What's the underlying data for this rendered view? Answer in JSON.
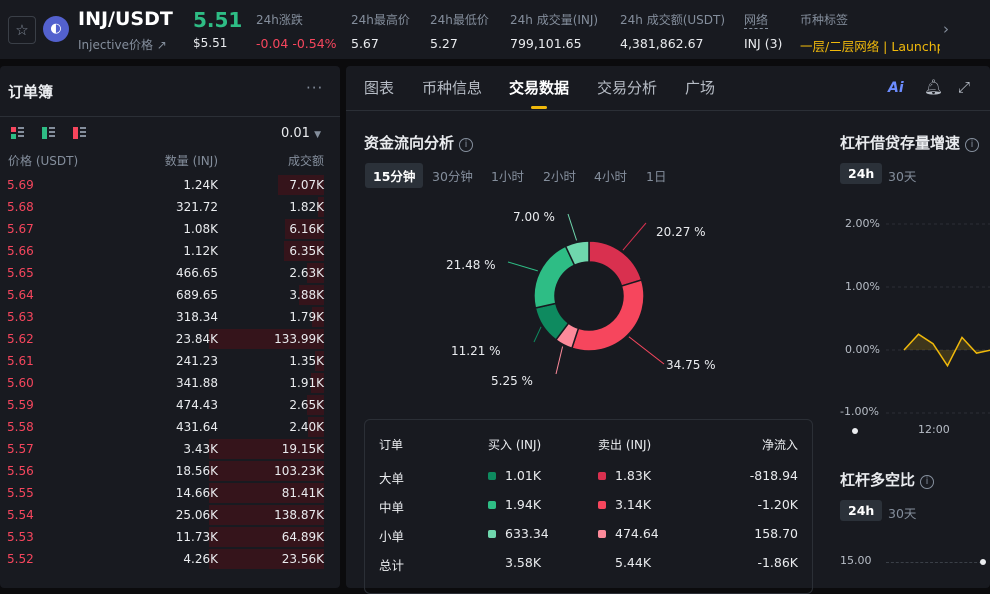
{
  "header": {
    "pair": "INJ/USDT",
    "subtitle": "Injective价格 ↗",
    "price": "5.51",
    "price_usd": "$5.51",
    "stats": [
      {
        "label": "24h涨跌",
        "value": "-0.04 -0.54%"
      },
      {
        "label": "24h最高价",
        "value": "5.67"
      },
      {
        "label": "24h最低价",
        "value": "5.27"
      },
      {
        "label": "24h 成交量(INJ)",
        "value": "799,101.65"
      },
      {
        "label": "24h 成交额(USDT)",
        "value": "4,381,862.67"
      },
      {
        "label": "网络",
        "value": "INJ (3)"
      },
      {
        "label": "币种标签",
        "value": "一层/二层网络 | Launchp"
      }
    ]
  },
  "orderbook": {
    "title": "订单簿",
    "more": "···",
    "precision": "0.01",
    "columns": {
      "price": "价格 (USDT)",
      "qty": "数量 (INJ)",
      "total": "成交额"
    },
    "rows": [
      {
        "price": "5.69",
        "qty": "1.24K",
        "total": "7.07K",
        "depth": 0.4
      },
      {
        "price": "5.68",
        "qty": "321.72",
        "total": "1.82K",
        "depth": 0.05
      },
      {
        "price": "5.67",
        "qty": "1.08K",
        "total": "6.16K",
        "depth": 0.34
      },
      {
        "price": "5.66",
        "qty": "1.12K",
        "total": "6.35K",
        "depth": 0.35
      },
      {
        "price": "5.65",
        "qty": "466.65",
        "total": "2.63K",
        "depth": 0.15
      },
      {
        "price": "5.64",
        "qty": "689.65",
        "total": "3.88K",
        "depth": 0.22
      },
      {
        "price": "5.63",
        "qty": "318.34",
        "total": "1.79K",
        "depth": 0.1
      },
      {
        "price": "5.62",
        "qty": "23.84K",
        "total": "133.99K",
        "depth": 1.0
      },
      {
        "price": "5.61",
        "qty": "241.23",
        "total": "1.35K",
        "depth": 0.08
      },
      {
        "price": "5.60",
        "qty": "341.88",
        "total": "1.91K",
        "depth": 0.11
      },
      {
        "price": "5.59",
        "qty": "474.43",
        "total": "2.65K",
        "depth": 0.15
      },
      {
        "price": "5.58",
        "qty": "431.64",
        "total": "2.40K",
        "depth": 0.14
      },
      {
        "price": "5.57",
        "qty": "3.43K",
        "total": "19.15K",
        "depth": 1.0
      },
      {
        "price": "5.56",
        "qty": "18.56K",
        "total": "103.23K",
        "depth": 1.0
      },
      {
        "price": "5.55",
        "qty": "14.66K",
        "total": "81.41K",
        "depth": 1.0
      },
      {
        "price": "5.54",
        "qty": "25.06K",
        "total": "138.87K",
        "depth": 1.0
      },
      {
        "price": "5.53",
        "qty": "11.73K",
        "total": "64.89K",
        "depth": 1.0
      },
      {
        "price": "5.52",
        "qty": "4.26K",
        "total": "23.56K",
        "depth": 1.0
      }
    ]
  },
  "tabs": [
    "图表",
    "币种信息",
    "交易数据",
    "交易分析",
    "广场"
  ],
  "active_tab": "交易数据",
  "icons": {
    "ai": "Ai",
    "bell": "bell-icon",
    "expand": "expand-icon"
  },
  "fund_flow": {
    "title": "资金流向分析",
    "timeframes": [
      "15分钟",
      "30分钟",
      "1小时",
      "2小时",
      "4小时",
      "1日"
    ],
    "active_timeframe": "15分钟",
    "table": {
      "headers": [
        "订单",
        "买入 (INJ)",
        "卖出 (INJ)",
        "净流入"
      ],
      "rows": [
        {
          "label": "大单",
          "buy": "1.01K",
          "sell": "1.83K",
          "net": "-818.94",
          "buy_color": "#0e8a5f",
          "sell_color": "#d9304f"
        },
        {
          "label": "中单",
          "buy": "1.94K",
          "sell": "3.14K",
          "net": "-1.20K",
          "buy_color": "#2ebd85",
          "sell_color": "#f6465d"
        },
        {
          "label": "小单",
          "buy": "633.34",
          "sell": "474.64",
          "net": "158.70",
          "buy_color": "#6fd7ad",
          "sell_color": "#fd8a9a"
        },
        {
          "label": "总计",
          "buy": "3.58K",
          "sell": "5.44K",
          "net": "-1.86K"
        }
      ]
    }
  },
  "chart_data": [
    {
      "type": "pie",
      "title": "资金流向分析",
      "slices": [
        {
          "label": "20.27 %",
          "value": 20.27,
          "color": "#d9304f"
        },
        {
          "label": "34.75 %",
          "value": 34.75,
          "color": "#f6465d"
        },
        {
          "label": "5.25 %",
          "value": 5.25,
          "color": "#fd8a9a"
        },
        {
          "label": "11.21 %",
          "value": 11.21,
          "color": "#0e8a5f"
        },
        {
          "label": "21.48 %",
          "value": 21.48,
          "color": "#2ebd85"
        },
        {
          "label": "7.00 %",
          "value": 7.0,
          "color": "#6fd7ad"
        }
      ]
    },
    {
      "type": "area",
      "title": "杠杆借贷存量增速",
      "timeframes": [
        "24h",
        "30天"
      ],
      "active_timeframe": "24h",
      "y_ticks": [
        "2.00%",
        "1.00%",
        "0.00%",
        "-1.00%"
      ],
      "ylim": [
        -1,
        2
      ],
      "x_ticks": [
        "12:00"
      ],
      "values": [
        0,
        0.25,
        0.1,
        -0.25,
        0.2,
        -0.05,
        0
      ]
    },
    {
      "type": "line",
      "title": "杠杆多空比",
      "timeframes": [
        "24h",
        "30天"
      ],
      "active_timeframe": "24h",
      "y_ticks": [
        "15.00"
      ]
    }
  ]
}
